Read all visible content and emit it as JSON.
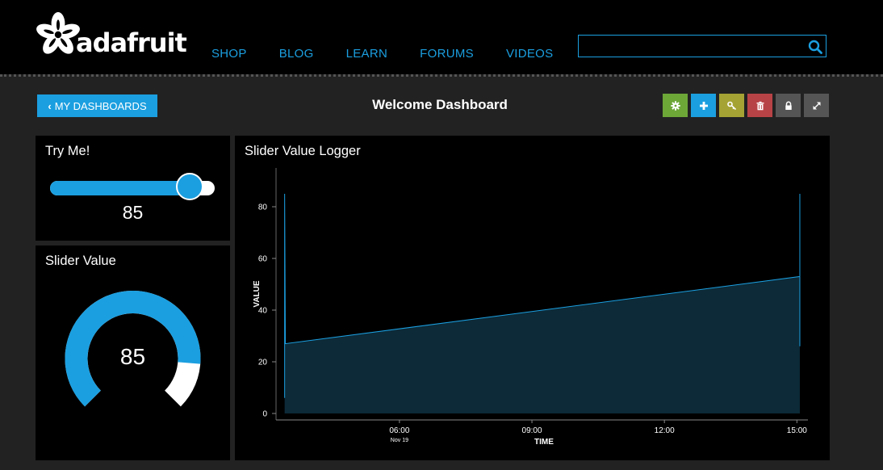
{
  "brand": {
    "logo_text": "adafruit"
  },
  "nav": {
    "items": [
      {
        "label": "SHOP"
      },
      {
        "label": "BLOG"
      },
      {
        "label": "LEARN"
      },
      {
        "label": "FORUMS"
      },
      {
        "label": "VIDEOS"
      }
    ]
  },
  "search": {
    "value": "",
    "placeholder": ""
  },
  "dashboard": {
    "back_label": "MY DASHBOARDS",
    "title": "Welcome Dashboard",
    "tools": [
      {
        "icon": "gear-icon",
        "color": "#6da738"
      },
      {
        "icon": "plus-icon",
        "color": "#1b9fe0"
      },
      {
        "icon": "key-icon",
        "color": "#a5a334"
      },
      {
        "icon": "trash-icon",
        "color": "#b84346"
      },
      {
        "icon": "lock-icon",
        "color": "#555555"
      },
      {
        "icon": "expand-icon",
        "color": "#555555"
      }
    ]
  },
  "colors": {
    "accent": "#1b9fe0",
    "panel_bg": "#000000",
    "page_bg": "#222222"
  },
  "blocks": {
    "try_me": {
      "title": "Try Me!",
      "value": 85,
      "min": 0,
      "max": 100
    },
    "slider_value": {
      "title": "Slider Value",
      "value": 85,
      "min": 0,
      "max": 100
    },
    "logger": {
      "title": "Slider Value Logger"
    }
  },
  "chart_data": {
    "type": "area",
    "title": "Slider Value Logger",
    "xlabel": "TIME",
    "ylabel": "VALUE",
    "ylim": [
      0,
      95
    ],
    "xlim": [
      "03:20",
      "15:15"
    ],
    "x_ticks": [
      {
        "label": "06:00",
        "sub": "Nov 19",
        "t": "06:00"
      },
      {
        "label": "09:00",
        "sub": "",
        "t": "09:00"
      },
      {
        "label": "12:00",
        "sub": "",
        "t": "12:00"
      },
      {
        "label": "15:00",
        "sub": "",
        "t": "15:00"
      }
    ],
    "y_ticks": [
      0,
      20,
      40,
      60,
      80
    ],
    "series": [
      {
        "points": [
          {
            "t": "03:24",
            "v": 6
          },
          {
            "t": "03:24",
            "v": 85
          },
          {
            "t": "03:25",
            "v": 27
          },
          {
            "t": "15:04",
            "v": 53
          },
          {
            "t": "15:04",
            "v": 85
          },
          {
            "t": "15:04",
            "v": 26
          }
        ]
      }
    ],
    "grid": false,
    "legend": "none"
  }
}
